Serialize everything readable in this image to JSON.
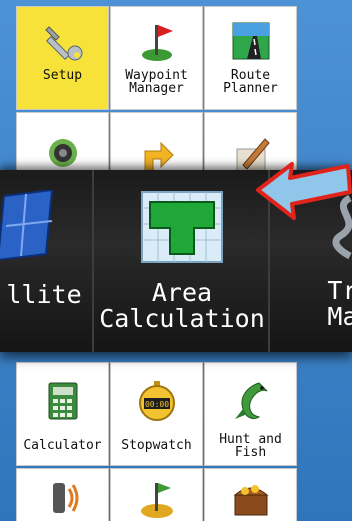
{
  "menu": {
    "row1": [
      {
        "label": "Setup",
        "icon": "wrench-icon",
        "selected": true
      },
      {
        "label": "Waypoint\nManager",
        "icon": "flag-icon",
        "selected": false
      },
      {
        "label": "Route\nPlanner",
        "icon": "road-icon",
        "selected": false
      }
    ],
    "row2_icons": [
      "speaker-icon",
      "arrow-turn-icon",
      "pencil-icon"
    ],
    "band": [
      {
        "label": "llite",
        "icon": "satellite-icon"
      },
      {
        "label": "Area\nCalculation",
        "icon": "area-grid-icon"
      },
      {
        "label": "Tra\nMan",
        "icon": "track-manager-icon"
      }
    ],
    "row4": [
      {
        "label": "Calculator",
        "icon": "calculator-icon"
      },
      {
        "label": "Stopwatch",
        "icon": "stopwatch-icon",
        "display": "00:00"
      },
      {
        "label": "Hunt and\nFish",
        "icon": "fish-icon"
      }
    ],
    "row5_icons": [
      "geocache-signal-icon",
      "golf-flag-icon",
      "treasure-chest-icon"
    ]
  },
  "colors": {
    "selected": "#f7e23a",
    "background": "#3a80c4",
    "callout_arrow": "#e0241c"
  }
}
